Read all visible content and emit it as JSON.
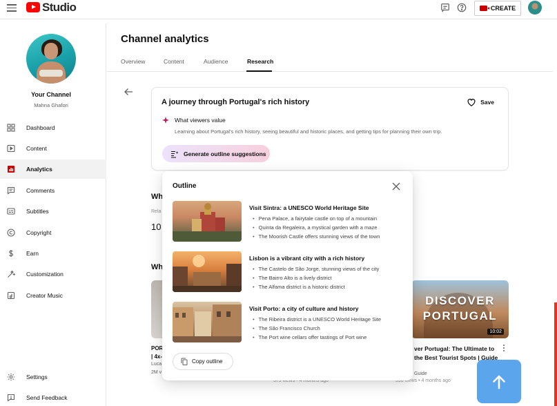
{
  "topbar": {
    "studio_label": "Studio",
    "create_label": "CREATE",
    "icons": [
      "menu-icon",
      "youtube-logo",
      "feedback-icon",
      "help-icon",
      "camera-icon",
      "avatar"
    ]
  },
  "sidebar": {
    "channel_name": "Your Channel",
    "channel_owner": "Mahna Ghafori",
    "items": [
      {
        "label": "Dashboard",
        "icon": "dashboard-icon"
      },
      {
        "label": "Content",
        "icon": "content-icon"
      },
      {
        "label": "Analytics",
        "icon": "analytics-icon",
        "active": true
      },
      {
        "label": "Comments",
        "icon": "comments-icon"
      },
      {
        "label": "Subtitles",
        "icon": "subtitles-icon"
      },
      {
        "label": "Copyright",
        "icon": "copyright-icon"
      },
      {
        "label": "Earn",
        "icon": "earn-icon"
      },
      {
        "label": "Customization",
        "icon": "customization-icon"
      },
      {
        "label": "Creator Music",
        "icon": "music-icon"
      }
    ],
    "bottom_items": [
      {
        "label": "Settings",
        "icon": "settings-icon"
      },
      {
        "label": "Send Feedback",
        "icon": "feedback-icon"
      }
    ]
  },
  "main": {
    "title": "Channel analytics",
    "tabs": [
      {
        "label": "Overview"
      },
      {
        "label": "Content"
      },
      {
        "label": "Audience"
      },
      {
        "label": "Research",
        "active": true
      }
    ]
  },
  "research_card": {
    "title": "A journey through Portugal's rich history",
    "save_label": "Save",
    "viewers_label": "What viewers value",
    "viewers_desc": "Learning about Portugal's rich history, seeing beautiful and historic places, and getting tips for planning their own trip.",
    "generate_label": "Generate outline suggestions"
  },
  "background": {
    "heading_1": "Wh",
    "small_1": "Rela",
    "number_1": "10",
    "heading_2": "Wh",
    "left_title_1": "POR",
    "left_title_2": "| 4x-",
    "left_meta_1": "Luca",
    "left_meta_2": "2M v",
    "discover_line_1": "DISCOVER",
    "discover_line_2": "PORTUGAL",
    "discover_duration": "10:02",
    "discover_title": "ver Portugal: The Ultimate to the Best Tourist Spots | Guide",
    "discover_meta": "Guide",
    "bottom_views_1": "379 views • 4 months ago",
    "bottom_views_2": "390 views • 4 months ago"
  },
  "outline": {
    "title": "Outline",
    "items": [
      {
        "heading": "Visit Sintra: a UNESCO World Heritage Site",
        "bullets": [
          "Pena Palace, a fairytale castle on top of a mountain",
          "Quinta da Regaleira, a mystical garden with a maze",
          "The Moorish Castle offers stunning views of the town"
        ]
      },
      {
        "heading": "Lisbon is a vibrant city with a rich history",
        "bullets": [
          "The Castelo de São Jorge, stunning views of the city",
          "The Bairro Alto is a lively district",
          "The Alfama district is a historic district"
        ]
      },
      {
        "heading": "Visit Porto: a city of culture and history",
        "bullets": [
          "The Ribeira district is a UNESCO World Heritage Site",
          "The São Francisco Church",
          "The Port wine cellars offer tastings of Port wine"
        ]
      }
    ],
    "copy_label": "Copy outline"
  },
  "colors": {
    "accent_red": "#ff0000",
    "analytics_active": "#cc0000",
    "scroll_button": "#5aa5ec"
  }
}
